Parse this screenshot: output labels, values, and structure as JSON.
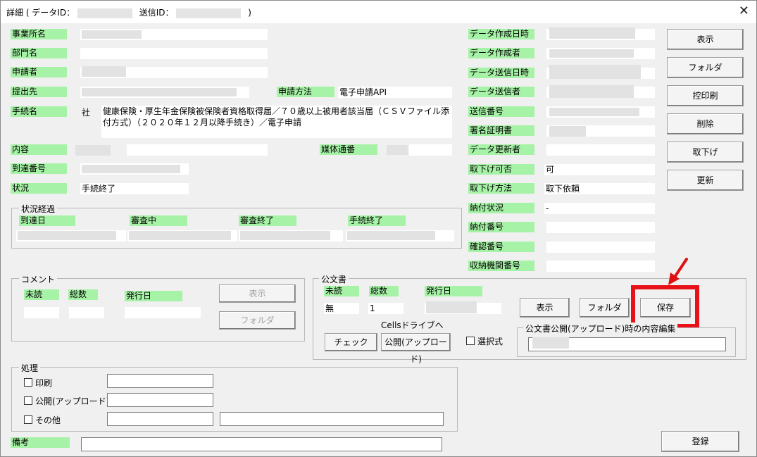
{
  "window": {
    "title_prefix": "詳細 ( データID：",
    "title_mid": "送信ID：",
    "title_suffix": ")",
    "close_glyph": "✕"
  },
  "labels": {
    "office": "事業所名",
    "dept": "部門名",
    "applicant": "申請者",
    "submit_to": "提出先",
    "apply_method": "申請方法",
    "procedure": "手続名",
    "content": "内容",
    "media_no": "媒体通番",
    "arrival_no": "到達番号",
    "status": "状況",
    "data_created_at": "データ作成日時",
    "data_creator": "データ作成者",
    "data_sent_at": "データ送信日時",
    "data_sender": "データ送信者",
    "send_no": "送信番号",
    "cert": "署名証明書",
    "data_updater": "データ更新者",
    "withdraw_ok": "取下げ可否",
    "withdraw_method": "取下げ方法",
    "payment_status": "納付状況",
    "payment_no": "納付番号",
    "confirm_no": "確認番号",
    "agency_no": "収納機関番号",
    "remarks": "備考"
  },
  "values": {
    "apply_method": "電子申請API",
    "procedure_prefix": "社",
    "procedure": "健康保険・厚生年金保険被保険者資格取得届／７０歳以上被用者該当届（ＣＳＶファイル添付方式）（２０２０年１２月以降手続き）／電子申請",
    "status": "手続終了",
    "withdraw_ok": "可",
    "withdraw_method": "取下依頼",
    "payment_status": "-"
  },
  "side_buttons": [
    "表示",
    "フォルダ",
    "控印刷",
    "削除",
    "取下げ",
    "更新"
  ],
  "progress": {
    "title": "状況経過",
    "cols": [
      "到達日",
      "審査中",
      "審査終了",
      "手続終了"
    ]
  },
  "comment": {
    "title": "コメント",
    "unread": "未読",
    "total": "総数",
    "issued": "発行日",
    "show": "表示",
    "folder": "フォルダ"
  },
  "official": {
    "title": "公文書",
    "unread": "未読",
    "total": "総数",
    "issued": "発行日",
    "unread_val": "無",
    "total_val": "1",
    "show": "表示",
    "folder": "フォルダ",
    "save": "保存",
    "cells_drive": "Cellsドライブへ",
    "check": "チェック",
    "publish": "公開(アップロード)",
    "select": "選択式",
    "edit_group": "公文書公開(アップロード)時の内容編集"
  },
  "process": {
    "title": "処理",
    "print": "印刷",
    "publish": "公開(アップロード)",
    "other": "その他"
  },
  "register": "登録",
  "colors": {
    "label_bg": "#a6f2a6",
    "highlight": "#e8111a",
    "arrow": "#e01010"
  }
}
